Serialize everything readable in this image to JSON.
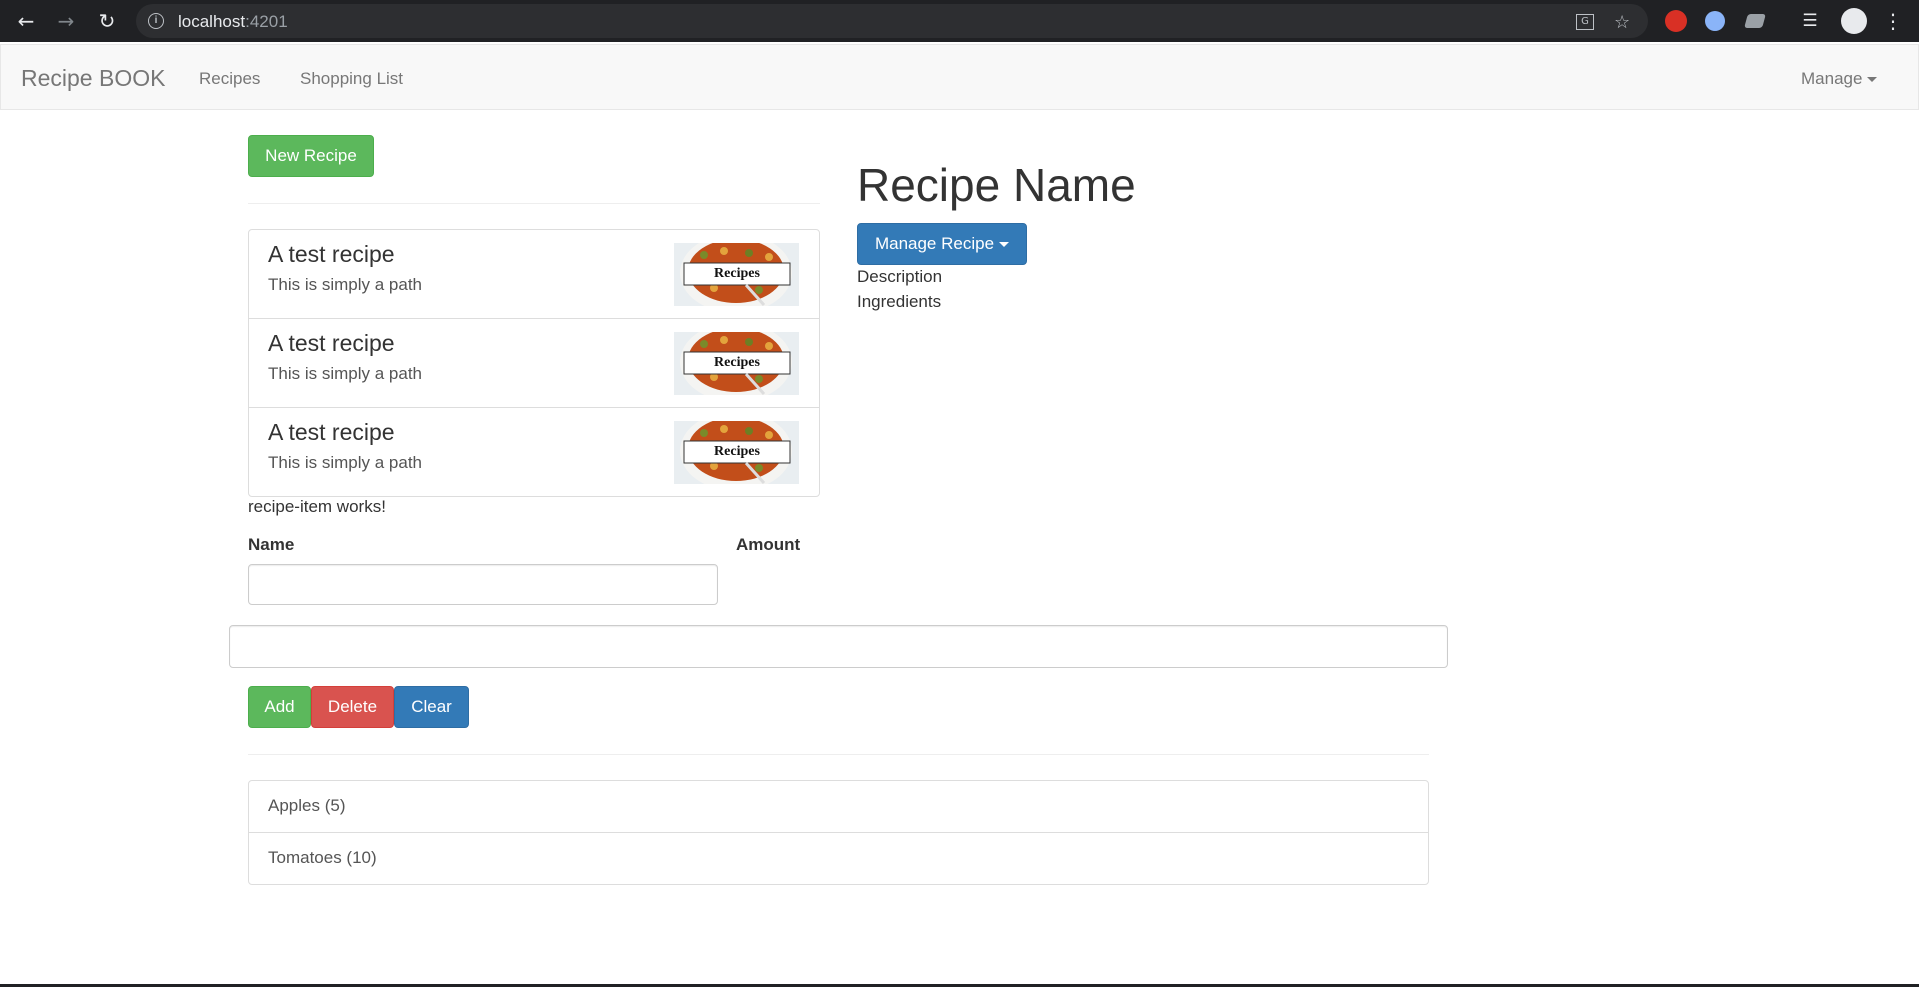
{
  "browser": {
    "host": "localhost",
    "port": ":4201",
    "icons": [
      "back-icon",
      "forward-icon",
      "reload-icon",
      "info-icon",
      "translate-icon",
      "star-icon",
      "extension-icon",
      "media-icon",
      "profile-icon",
      "menu-icon"
    ]
  },
  "navbar": {
    "brand": "Recipe BOOK",
    "links": [
      "Recipes",
      "Shopping List"
    ],
    "manage": "Manage"
  },
  "recipes": {
    "new_button": "New Recipe",
    "items": [
      {
        "name": "A test recipe",
        "description": "This is simply a path",
        "image_text": "Recipes"
      },
      {
        "name": "A test recipe",
        "description": "This is simply a path",
        "image_text": "Recipes"
      },
      {
        "name": "A test recipe",
        "description": "This is simply a path",
        "image_text": "Recipes"
      }
    ],
    "item_works": "recipe-item works!"
  },
  "detail": {
    "title": "Recipe Name",
    "manage_button": "Manage Recipe",
    "description": "Description",
    "ingredients": "Ingredients"
  },
  "shopping": {
    "name_label": "Name",
    "amount_label": "Amount",
    "name_value": "",
    "amount_value": "",
    "add": "Add",
    "delete": "Delete",
    "clear": "Clear",
    "items": [
      "Apples (5)",
      "Tomatoes (10)"
    ]
  },
  "colors": {
    "success": "#5cb85c",
    "danger": "#d9534f",
    "primary": "#337ab7",
    "chrome": "#202124"
  }
}
